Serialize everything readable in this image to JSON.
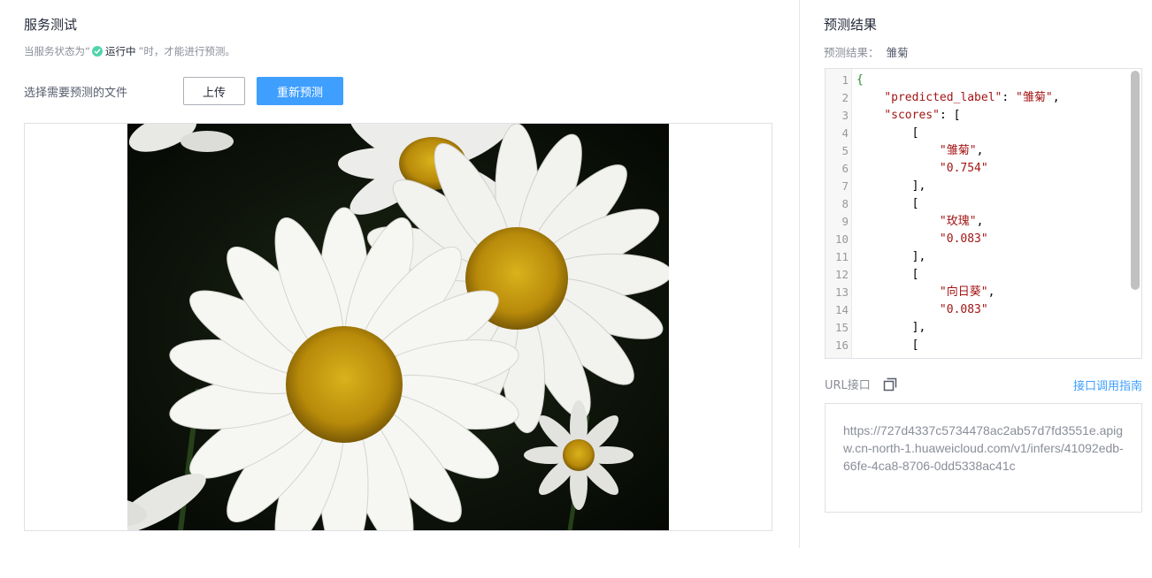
{
  "left": {
    "title": "服务测试",
    "status": {
      "prefix": "当服务状态为“",
      "state": "运行中",
      "suffix": "”时，才能进行预测。"
    },
    "file_label": "选择需要预测的文件",
    "upload_label": "上传",
    "repredict_label": "重新预测"
  },
  "right": {
    "title": "预测结果",
    "result_label": "预测结果：",
    "result_value": "雏菊",
    "code_lines": [
      {
        "n": "1",
        "text": "{"
      },
      {
        "n": "2",
        "text": "    \"predicted_label\": \"雏菊\","
      },
      {
        "n": "3",
        "text": "    \"scores\": ["
      },
      {
        "n": "4",
        "text": "        ["
      },
      {
        "n": "5",
        "text": "            \"雏菊\","
      },
      {
        "n": "6",
        "text": "            \"0.754\""
      },
      {
        "n": "7",
        "text": "        ],"
      },
      {
        "n": "8",
        "text": "        ["
      },
      {
        "n": "9",
        "text": "            \"玫瑰\","
      },
      {
        "n": "10",
        "text": "            \"0.083\""
      },
      {
        "n": "11",
        "text": "        ],"
      },
      {
        "n": "12",
        "text": "        ["
      },
      {
        "n": "13",
        "text": "            \"向日葵\","
      },
      {
        "n": "14",
        "text": "            \"0.083\""
      },
      {
        "n": "15",
        "text": "        ],"
      },
      {
        "n": "16",
        "text": "        ["
      }
    ],
    "url_label": "URL接口",
    "guide_link": "接口调用指南",
    "url": "https://727d4337c5734478ac2ab57d7fd3551e.apigw.cn-north-1.huaweicloud.com/v1/infers/41092edb-66fe-4ca8-8706-0dd5338ac41c"
  },
  "colors": {
    "primary": "#3f9fff",
    "status_ok": "#50d4ab"
  }
}
